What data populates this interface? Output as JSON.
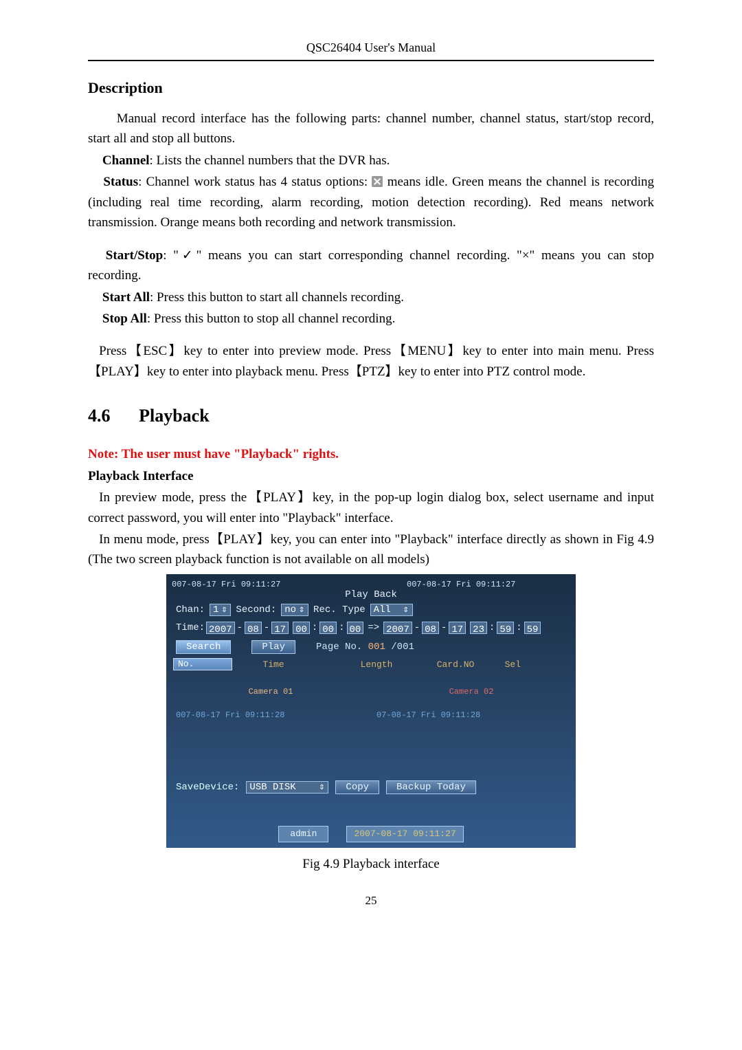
{
  "header": {
    "title": "QSC26404 User's Manual"
  },
  "description": {
    "heading": "Description",
    "intro": "Manual record interface has the following parts: channel number, channel status, start/stop record, start all and stop all buttons.",
    "channel_label": "Channel",
    "channel_text": ": Lists the channel numbers that the DVR has.",
    "status_label": "Status",
    "status_text_a": ": Channel work status has 4 status options: ",
    "status_text_b": " means idle. Green means the channel is recording (including real time recording, alarm recording, motion detection recording). Red means network transmission. Orange means both recording and network transmission.",
    "startstop_label": "Start/Stop",
    "startstop_text": ": \"✓\" means you can start corresponding channel recording. \"×\" means you can stop recording.",
    "startall_label": "Start All",
    "startall_text": ": Press this button to start all channels recording.",
    "stopall_label": "Stop All",
    "stopall_text": ": Press this button to stop all channel recording.",
    "keys_text": "Press【ESC】key to enter into preview mode. Press【MENU】key to enter into main menu. Press【PLAY】key to enter into playback menu. Press【PTZ】key to enter into PTZ control mode."
  },
  "section": {
    "num": "4.6",
    "title": "Playback",
    "note": "Note: The user must have \"Playback\" rights.",
    "sub": "Playback Interface",
    "p1": "In preview mode, press the【PLAY】key, in the pop-up login dialog box, select username and input correct password, you will enter into \"Playback\" interface.",
    "p2": "In menu mode, press【PLAY】key, you can enter into \"Playback\" interface directly as shown in Fig 4.9 (The two screen playback function is not available on all models)"
  },
  "playback": {
    "ts_left": "007-08-17 Fri 09:11:27",
    "ts_right": "007-08-17 Fri 09:11:27",
    "title": "Play Back",
    "chan_lbl": "Chan:",
    "chan_val": "1",
    "second_lbl": "Second:",
    "second_val": "no",
    "rectype_lbl": "Rec. Type",
    "rectype_val": "All",
    "time_lbl": "Time:",
    "t_from": {
      "y": "2007",
      "mo": "08",
      "d": "17",
      "h": "00",
      "mi": "00",
      "s": "00"
    },
    "t_to": {
      "y": "2007",
      "mo": "08",
      "d": "17",
      "h": "23",
      "mi": "59",
      "s": "59"
    },
    "search_btn": "Search",
    "play_btn": "Play",
    "pageno_lbl": "Page No.",
    "pageno_cur": "001",
    "pageno_tot": "/001",
    "cols": {
      "no": "No.",
      "time": "Time",
      "len": "Length",
      "card": "Card.NO",
      "sel": "Sel"
    },
    "cam1": "Camera 01",
    "cam2": "Camera 02",
    "panel_ts_l": "007-08-17 Fri 09:11:28",
    "panel_ts_r": "07-08-17 Fri 09:11:28",
    "save_lbl": "SaveDevice:",
    "save_val": "USB DISK",
    "copy_btn": "Copy",
    "backup_btn": "Backup Today",
    "user": "admin",
    "status_date": "2007-08-17 09:11:27"
  },
  "caption": "Fig 4.9 Playback interface",
  "page_number": "25"
}
